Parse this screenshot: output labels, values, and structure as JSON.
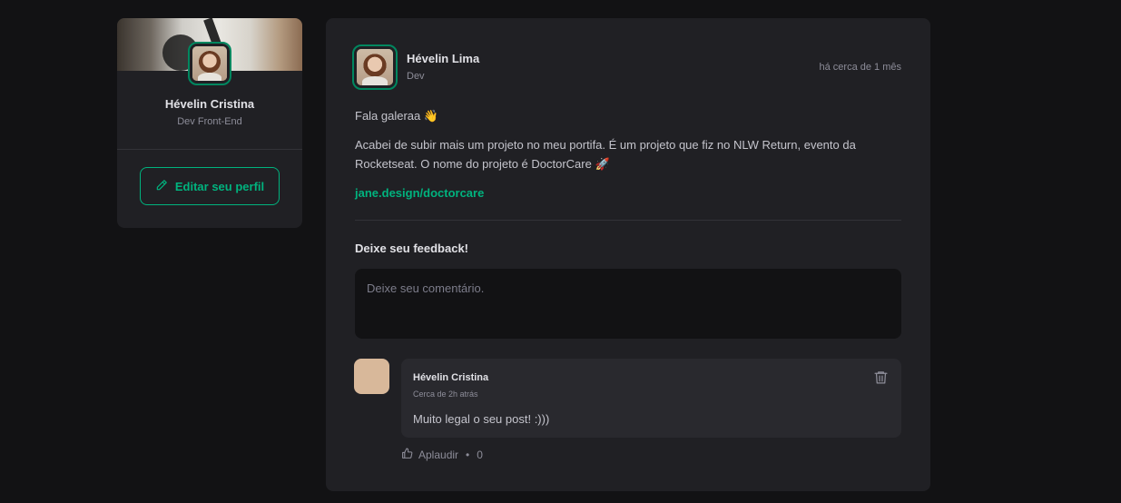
{
  "colors": {
    "background": "#121214",
    "card": "#202024",
    "accent": "#00b37e",
    "comment_box": "#29292e",
    "muted": "#8d8d99"
  },
  "sidebar": {
    "cover_image": "cover-photo",
    "avatar": "user-avatar",
    "name": "Hévelin Cristina",
    "role": "Dev Front-End",
    "edit_button_icon": "pencil-icon",
    "edit_button_label": "Editar seu perfil"
  },
  "post": {
    "author": {
      "avatar": "author-avatar",
      "name": "Hévelin Lima",
      "role": "Dev"
    },
    "published": "há cerca de 1 mês",
    "greeting": "Fala galeraa 👋",
    "body": "Acabei de subir mais um projeto no meu portifa. É um projeto que fiz no NLW Return, evento da Rocketseat. O nome do projeto é DoctorCare 🚀",
    "link": "jane.design/doctorcare",
    "feedback_title": "Deixe seu feedback!",
    "comment_placeholder": "Deixe seu comentário."
  },
  "comments": [
    {
      "avatar": "commenter-avatar",
      "author": "Hévelin Cristina",
      "time": "Cerca de 2h atrás",
      "text": "Muito legal o seu post! :)))",
      "delete_icon": "trash-icon",
      "applaud_icon": "thumbs-up-icon",
      "applaud_label": "Aplaudir",
      "separator": "•",
      "applaud_count": "0"
    }
  ]
}
